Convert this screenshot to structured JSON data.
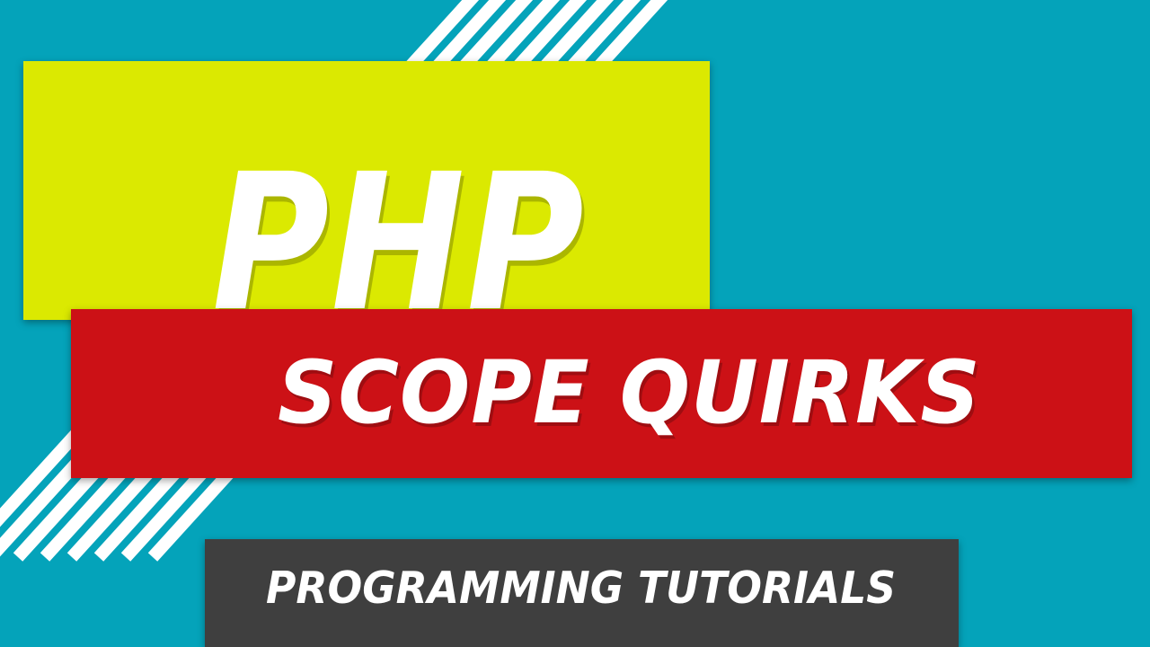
{
  "thumbnail": {
    "title": "PHP",
    "subtitle": "SCOPE QUIRKS",
    "series_label": "PROGRAMMING TUTORIALS"
  },
  "colors": {
    "background": "#04a3ba",
    "stripes": "#ffffff",
    "title_banner": "#dbe901",
    "subtitle_banner": "#cc1116",
    "series_banner": "#3f3f3f",
    "text": "#ffffff"
  }
}
